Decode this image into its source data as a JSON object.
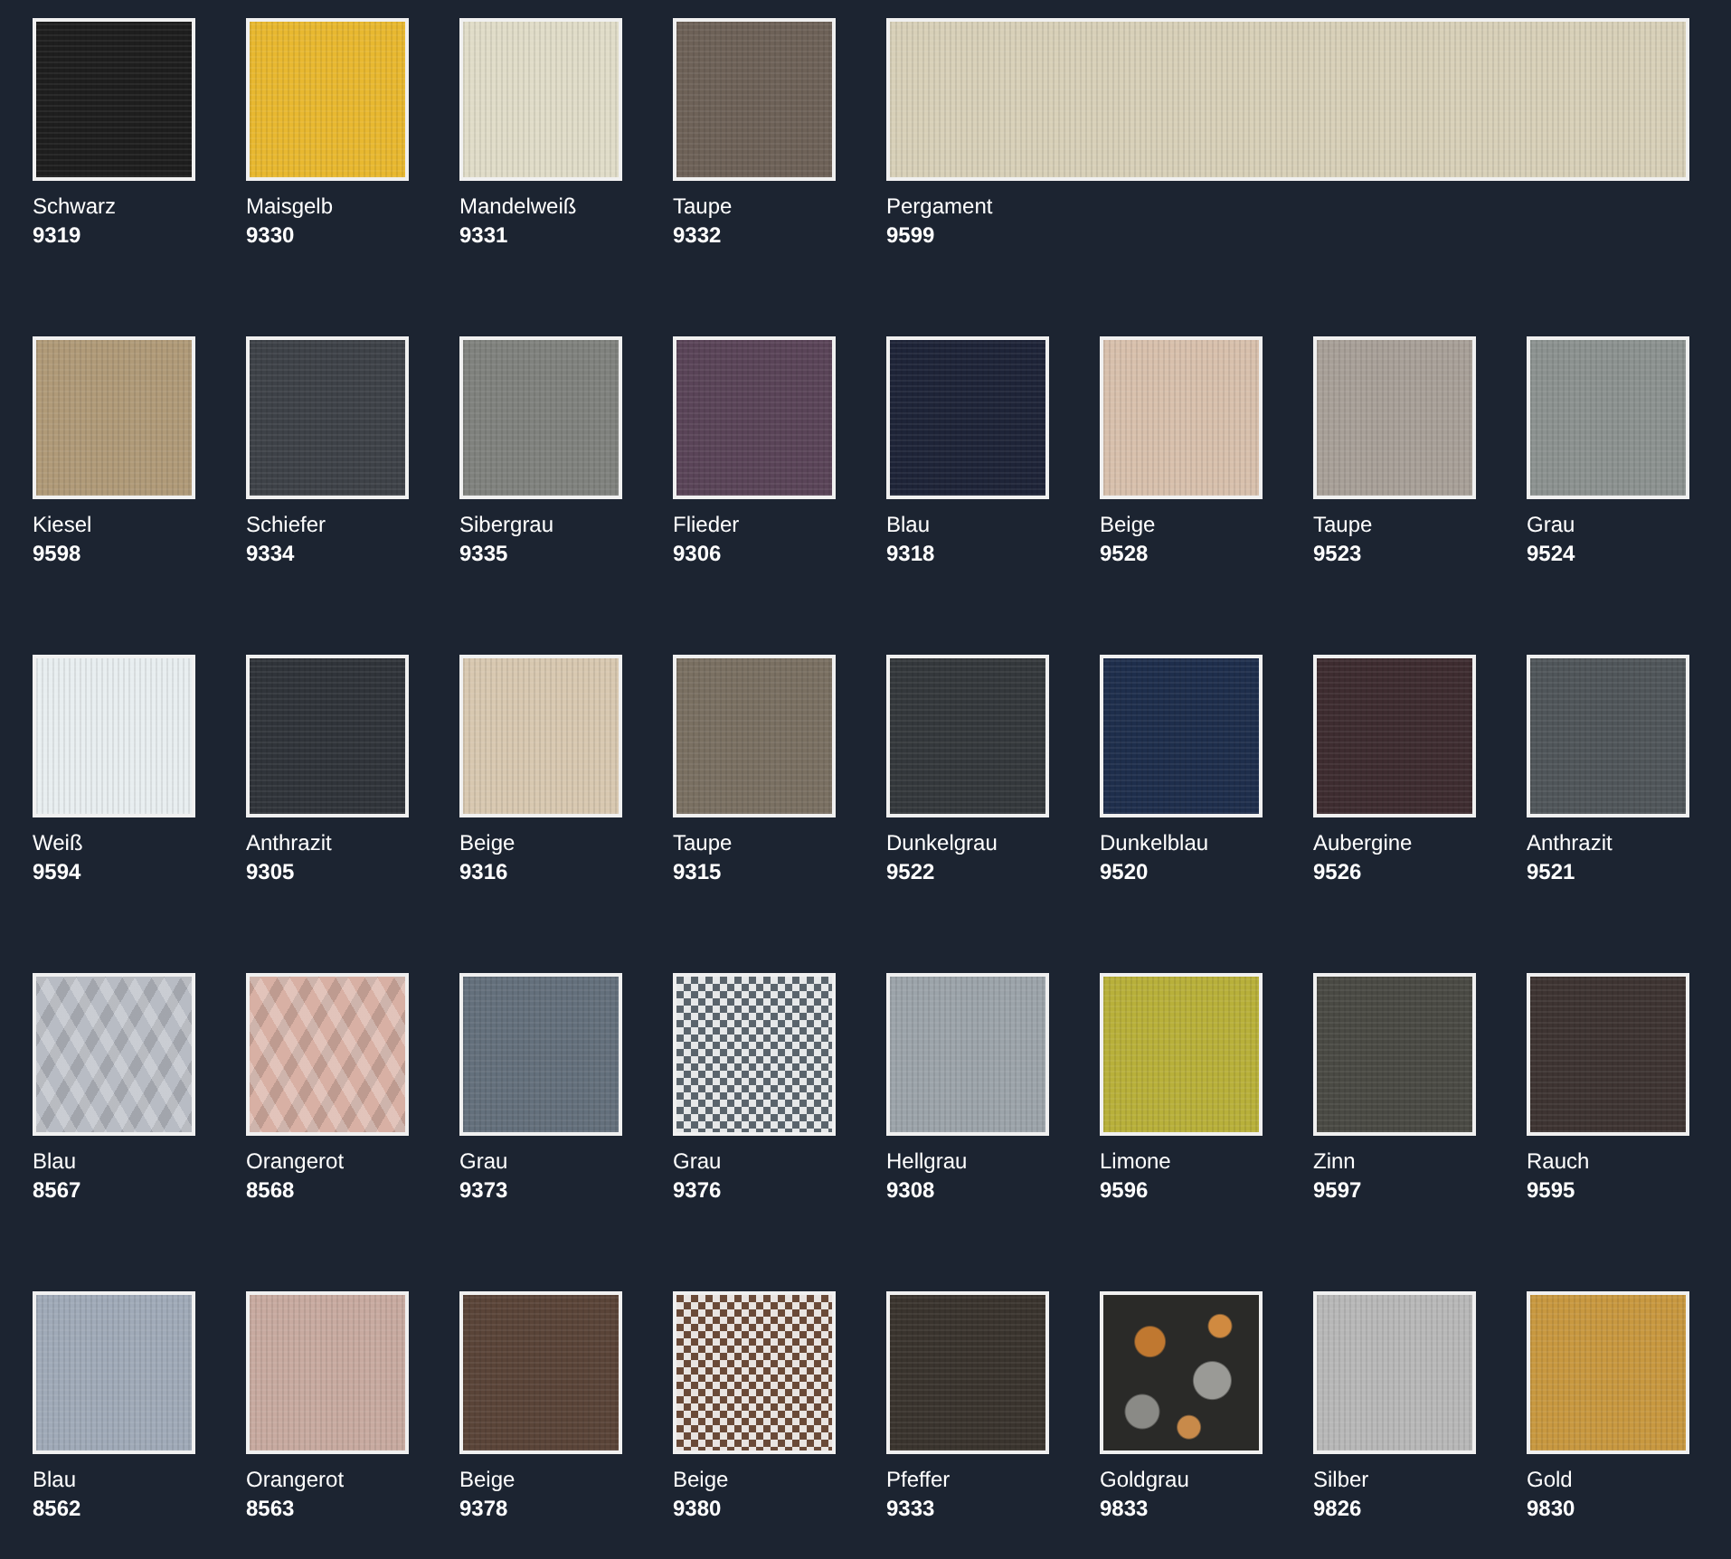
{
  "rows": [
    {
      "items": [
        {
          "name": "Schwarz",
          "code": "9319",
          "color": "#1e1e1e",
          "kind": "plain",
          "wide": false
        },
        {
          "name": "Maisgelb",
          "code": "9330",
          "color": "#e8b830",
          "kind": "plain",
          "wide": false
        },
        {
          "name": "Mandelweiß",
          "code": "9331",
          "color": "#e0dcc8",
          "kind": "plain",
          "wide": false
        },
        {
          "name": "Taupe",
          "code": "9332",
          "color": "#6e6258",
          "kind": "plain",
          "wide": false
        },
        {
          "name": "Pergament",
          "code": "9599",
          "color": "#d8d0b8",
          "kind": "plain",
          "wide": true
        }
      ]
    },
    {
      "items": [
        {
          "name": "Kiesel",
          "code": "9598",
          "color": "#b09a78",
          "kind": "plain",
          "wide": false
        },
        {
          "name": "Schiefer",
          "code": "9334",
          "color": "#3e4248",
          "kind": "plain",
          "wide": false
        },
        {
          "name": "Sibergrau",
          "code": "9335",
          "color": "#80827e",
          "kind": "plain",
          "wide": false
        },
        {
          "name": "Flieder",
          "code": "9306",
          "color": "#5a4458",
          "kind": "plain",
          "wide": false
        },
        {
          "name": "Blau",
          "code": "9318",
          "color": "#1e2438",
          "kind": "plain",
          "wide": false
        },
        {
          "name": "Beige",
          "code": "9528",
          "color": "#d8c0ac",
          "kind": "plain",
          "wide": false
        },
        {
          "name": "Taupe",
          "code": "9523",
          "color": "#a8a098",
          "kind": "plain",
          "wide": false
        },
        {
          "name": "Grau",
          "code": "9524",
          "color": "#8c9290",
          "kind": "plain",
          "wide": false
        }
      ]
    },
    {
      "items": [
        {
          "name": "Weiß",
          "code": "9594",
          "color": "#e8eef0",
          "kind": "plain",
          "wide": false
        },
        {
          "name": "Anthrazit",
          "code": "9305",
          "color": "#30343a",
          "kind": "plain",
          "wide": false
        },
        {
          "name": "Beige",
          "code": "9316",
          "color": "#d8c8b0",
          "kind": "plain",
          "wide": false
        },
        {
          "name": "Taupe",
          "code": "9315",
          "color": "#7a7062",
          "kind": "plain",
          "wide": false
        },
        {
          "name": "Dunkelgrau",
          "code": "9522",
          "color": "#34383c",
          "kind": "plain",
          "wide": false
        },
        {
          "name": "Dunkelblau",
          "code": "9520",
          "color": "#1e2e4c",
          "kind": "plain",
          "wide": false
        },
        {
          "name": "Aubergine",
          "code": "9526",
          "color": "#3e2c30",
          "kind": "plain",
          "wide": false
        },
        {
          "name": "Anthrazit",
          "code": "9521",
          "color": "#50565a",
          "kind": "plain",
          "wide": false
        }
      ]
    },
    {
      "items": [
        {
          "name": "Blau",
          "code": "8567",
          "color": "#b8bcc4",
          "kind": "cable",
          "wide": false
        },
        {
          "name": "Orangerot",
          "code": "8568",
          "color": "#d8b0a4",
          "kind": "cable",
          "wide": false
        },
        {
          "name": "Grau",
          "code": "9373",
          "color": "#64707c",
          "kind": "plain",
          "wide": false
        },
        {
          "name": "Grau",
          "code": "9376",
          "color": "#5a646c",
          "kind": "houndstooth",
          "wide": false
        },
        {
          "name": "Hellgrau",
          "code": "9308",
          "color": "#9ca4aa",
          "kind": "plain",
          "wide": false
        },
        {
          "name": "Limone",
          "code": "9596",
          "color": "#b8b03a",
          "kind": "plain",
          "wide": false
        },
        {
          "name": "Zinn",
          "code": "9597",
          "color": "#4a4a44",
          "kind": "plain",
          "wide": false
        },
        {
          "name": "Rauch",
          "code": "9595",
          "color": "#3e3432",
          "kind": "plain",
          "wide": false
        }
      ]
    },
    {
      "items": [
        {
          "name": "Blau",
          "code": "8562",
          "color": "#a0aab8",
          "kind": "plain",
          "wide": false
        },
        {
          "name": "Orangerot",
          "code": "8563",
          "color": "#c8aaa0",
          "kind": "plain",
          "wide": false
        },
        {
          "name": "Beige",
          "code": "9378",
          "color": "#5a4438",
          "kind": "plain",
          "wide": false
        },
        {
          "name": "Beige",
          "code": "9380",
          "color": "#6a4a38",
          "kind": "houndstooth",
          "wide": false
        },
        {
          "name": "Pfeffer",
          "code": "9333",
          "color": "#3a342e",
          "kind": "plain",
          "wide": false
        },
        {
          "name": "Goldgrau",
          "code": "9833",
          "color": "#2a2a28",
          "kind": "floral",
          "wide": false
        },
        {
          "name": "Silber",
          "code": "9826",
          "color": "#b8b8b8",
          "kind": "plain",
          "wide": false
        },
        {
          "name": "Gold",
          "code": "9830",
          "color": "#c89840",
          "kind": "plain",
          "wide": false
        }
      ]
    }
  ]
}
